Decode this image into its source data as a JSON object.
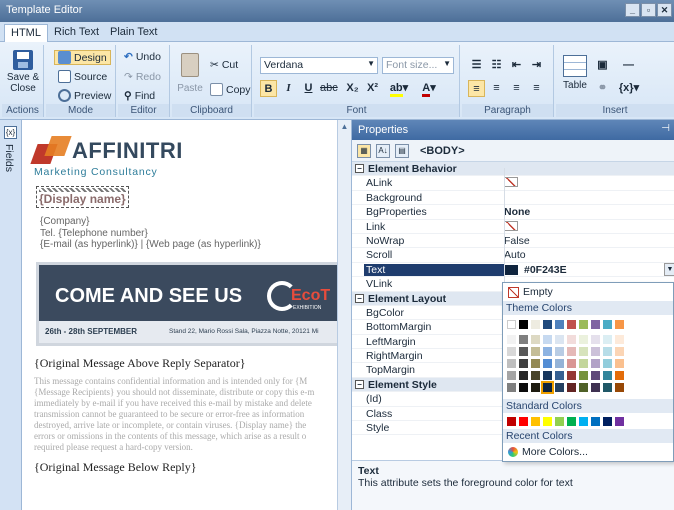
{
  "window": {
    "title": "Template Editor"
  },
  "tabs": [
    "HTML",
    "Rich Text",
    "Plain Text"
  ],
  "ribbon": {
    "actions": {
      "save_close": "Save & Close",
      "label": "Actions"
    },
    "mode": {
      "design": "Design",
      "source": "Source",
      "preview": "Preview",
      "label": "Mode"
    },
    "editor": {
      "undo": "Undo",
      "redo": "Redo",
      "find": "Find",
      "label": "Editor"
    },
    "clipboard": {
      "paste": "Paste",
      "cut": "Cut",
      "copy": "Copy",
      "label": "Clipboard"
    },
    "font": {
      "family": "Verdana",
      "size_placeholder": "Font size...",
      "label": "Font"
    },
    "paragraph": {
      "label": "Paragraph"
    },
    "insert": {
      "table": "Table",
      "label": "Insert"
    }
  },
  "side": {
    "fields_label": "Fields"
  },
  "editor_doc": {
    "logo": "AFFINITRI",
    "tagline": "Marketing Consultancy",
    "display_name": "{Display name}",
    "company": "{Company}",
    "telephone": "Tel. {Telephone number}",
    "email_web": "{E-mail (as hyperlink)} | {Web page (as hyperlink)}",
    "banner_title": "COME AND SEE US",
    "banner_brand": "EcoT",
    "banner_sub": "EXHIBITION",
    "banner_date": "26th - 28th SEPTEMBER",
    "banner_address": "Stand 22, Mario Rossi Sala, Piazza Notte, 20121 Mi",
    "sep_above": "{Original Message Above Reply Separator}",
    "disclaimer": [
      "This message contains confidential information and is intended only for {M",
      "{Message Recipients} you should not disseminate, distribute or copy this e-m",
      "immediately by e-mail if you have received this e-mail by mistake and delete",
      "transmission cannot be guaranteed to be secure or error-free as information",
      "destroyed, arrive late or incomplete, or contain viruses. {Display name} the",
      "errors or omissions in the contents of this message, which arise as a result o",
      "required please request a hard-copy version."
    ],
    "sep_below": "{Original Message Below Reply}"
  },
  "properties": {
    "title": "Properties",
    "object": "<BODY>",
    "rows": [
      {
        "type": "cat",
        "name": "Element Behavior"
      },
      {
        "name": "ALink",
        "val": "",
        "color_icon": true
      },
      {
        "name": "Background",
        "val": ""
      },
      {
        "name": "BgProperties",
        "val": "None",
        "bold": true
      },
      {
        "name": "Link",
        "val": "",
        "color_icon": true
      },
      {
        "name": "NoWrap",
        "val": "False"
      },
      {
        "name": "Scroll",
        "val": "Auto"
      },
      {
        "name": "Text",
        "val": "#0F243E",
        "selected": true,
        "swatch": "#0F243E"
      },
      {
        "name": "VLink",
        "val": ""
      },
      {
        "type": "cat",
        "name": "Element Layout"
      },
      {
        "name": "BgColor",
        "val": ""
      },
      {
        "name": "BottomMargin",
        "val": ""
      },
      {
        "name": "LeftMargin",
        "val": ""
      },
      {
        "name": "RightMargin",
        "val": ""
      },
      {
        "name": "TopMargin",
        "val": ""
      },
      {
        "type": "cat",
        "name": "Element Style"
      },
      {
        "name": "(Id)",
        "val": ""
      },
      {
        "name": "Class",
        "val": ""
      },
      {
        "name": "Style",
        "val": ""
      }
    ],
    "desc_title": "Text",
    "desc_text": "This attribute sets the foreground color for text"
  },
  "color_picker": {
    "empty": "Empty",
    "theme_header": "Theme Colors",
    "standard_header": "Standard Colors",
    "recent_header": "Recent Colors",
    "more_colors": "More Colors...",
    "theme_top": [
      "#ffffff",
      "#000000",
      "#eeece1",
      "#1f497d",
      "#4f81bd",
      "#c0504d",
      "#9bbb59",
      "#8064a2",
      "#4bacc6",
      "#f79646"
    ],
    "theme_shades": [
      [
        "#f2f2f2",
        "#7f7f7f",
        "#ddd9c3",
        "#c6d9f0",
        "#dbe5f1",
        "#f2dcdb",
        "#ebf1dd",
        "#e5e0ec",
        "#dbeef3",
        "#fdeada"
      ],
      [
        "#d8d8d8",
        "#595959",
        "#c4bd97",
        "#8db3e2",
        "#b8cce4",
        "#e5b9b7",
        "#d7e3bc",
        "#ccc1d9",
        "#b7dde8",
        "#fbd5b5"
      ],
      [
        "#bfbfbf",
        "#3f3f3f",
        "#938953",
        "#548dd4",
        "#95b3d7",
        "#d99694",
        "#c3d69b",
        "#b2a2c7",
        "#92cddc",
        "#fac08f"
      ],
      [
        "#a5a5a5",
        "#262626",
        "#494429",
        "#17365d",
        "#366092",
        "#953734",
        "#76923c",
        "#5f497a",
        "#31859b",
        "#e36c09"
      ],
      [
        "#7f7f7f",
        "#0c0c0c",
        "#1d1b10",
        "#0f243e",
        "#244061",
        "#632423",
        "#4f6128",
        "#3f3151",
        "#205867",
        "#974806"
      ]
    ],
    "standard": [
      "#c00000",
      "#ff0000",
      "#ffc000",
      "#ffff00",
      "#92d050",
      "#00b050",
      "#00b0f0",
      "#0070c0",
      "#002060",
      "#7030a0"
    ],
    "selected_color": "#0f243e"
  }
}
